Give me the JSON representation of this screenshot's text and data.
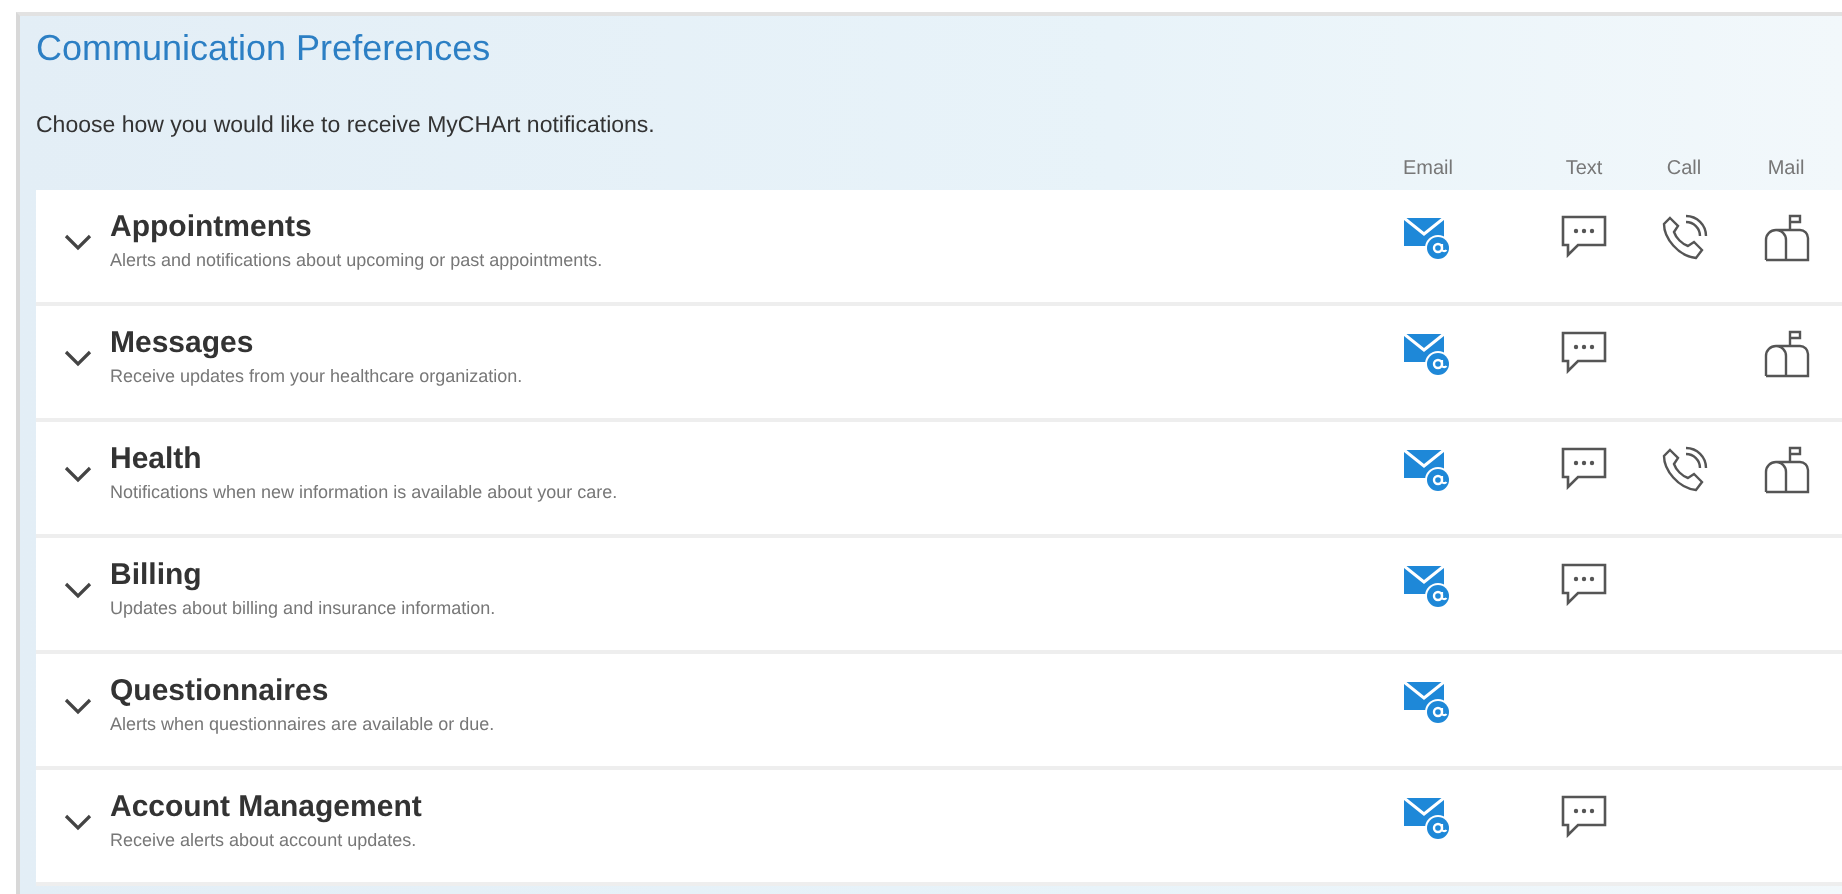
{
  "title": "Communication Preferences",
  "intro": "Choose how you would like to receive MyCHArt notifications.",
  "columns": [
    {
      "kind": "email",
      "label": "Email"
    },
    {
      "kind": "text",
      "label": "Text"
    },
    {
      "kind": "call",
      "label": "Call"
    },
    {
      "kind": "mail",
      "label": "Mail"
    }
  ],
  "rows": [
    {
      "title": "Appointments",
      "description": "Alerts and notifications about upcoming or past appointments.",
      "expanded": false,
      "channels": [
        {
          "kind": "email",
          "on": true
        },
        {
          "kind": "text",
          "on": false
        },
        {
          "kind": "call",
          "on": false
        },
        {
          "kind": "mail",
          "on": false
        }
      ]
    },
    {
      "title": "Messages",
      "description": "Receive updates from your healthcare organization.",
      "expanded": false,
      "channels": [
        {
          "kind": "email",
          "on": true
        },
        {
          "kind": "text",
          "on": false
        },
        {
          "kind": "mail",
          "on": false
        }
      ]
    },
    {
      "title": "Health",
      "description": "Notifications when new information is available about your care.",
      "expanded": false,
      "channels": [
        {
          "kind": "email",
          "on": true
        },
        {
          "kind": "text",
          "on": false
        },
        {
          "kind": "call",
          "on": false
        },
        {
          "kind": "mail",
          "on": false
        }
      ]
    },
    {
      "title": "Billing",
      "description": "Updates about billing and insurance information.",
      "expanded": false,
      "channels": [
        {
          "kind": "email",
          "on": true
        },
        {
          "kind": "text",
          "on": false
        }
      ]
    },
    {
      "title": "Questionnaires",
      "description": "Alerts when questionnaires are available or due.",
      "expanded": false,
      "channels": [
        {
          "kind": "email",
          "on": true
        }
      ]
    },
    {
      "title": "Account Management",
      "description": "Receive alerts about account updates.",
      "expanded": false,
      "channels": [
        {
          "kind": "email",
          "on": true
        },
        {
          "kind": "text",
          "on": false
        }
      ]
    }
  ]
}
